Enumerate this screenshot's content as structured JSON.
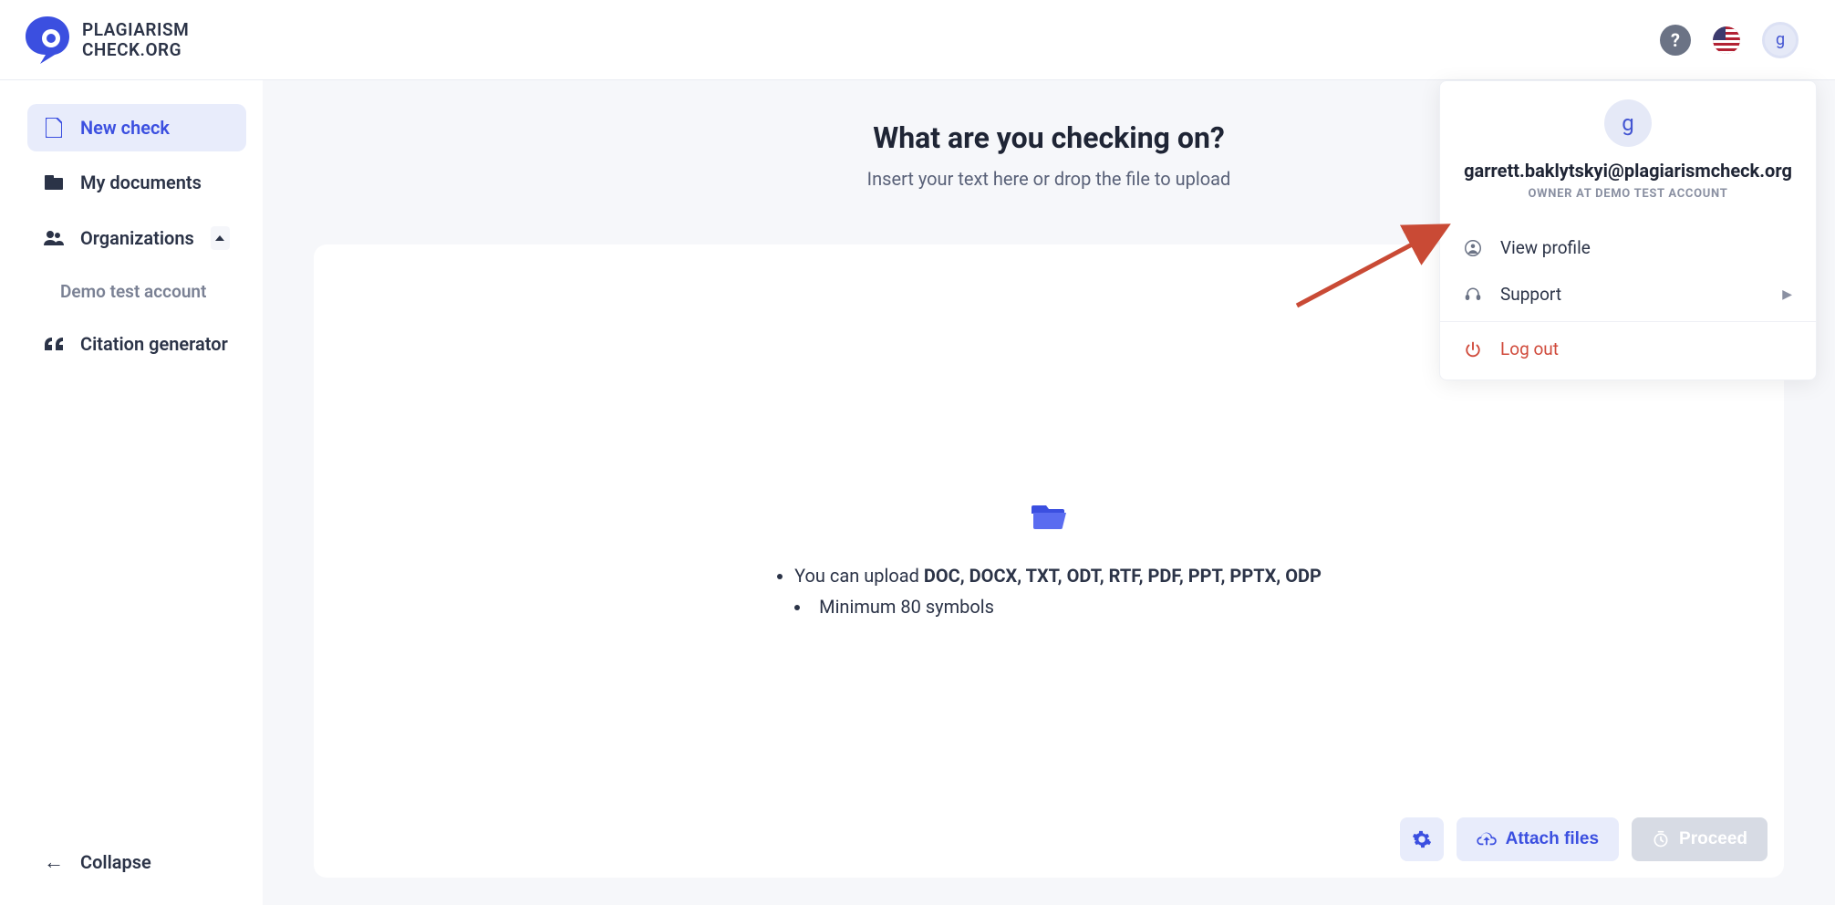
{
  "brand": {
    "line1": "PLAGIARISM",
    "line2": "CHECK.ORG"
  },
  "header": {
    "avatar_initial": "g"
  },
  "sidebar": {
    "items": [
      {
        "label": "New check"
      },
      {
        "label": "My documents"
      },
      {
        "label": "Organizations"
      },
      {
        "label": "Citation generator"
      }
    ],
    "org_sub": "Demo test account",
    "collapse": "Collapse"
  },
  "main": {
    "title": "What are you checking on?",
    "subtitle": "Insert your text here or drop the file to upload",
    "upload_prefix": "You can upload ",
    "upload_formats": "DOC, DOCX, TXT, ODT, RTF, PDF, PPT, PPTX, ODP",
    "min_symbols": "Minimum 80 symbols",
    "attach_label": "Attach files",
    "proceed_label": "Proceed"
  },
  "profile": {
    "avatar_initial": "g",
    "email": "garrett.baklytskyi@plagiarismcheck.org",
    "role": "OWNER AT DEMO TEST ACCOUNT",
    "view_profile": "View profile",
    "support": "Support",
    "logout": "Log out"
  }
}
